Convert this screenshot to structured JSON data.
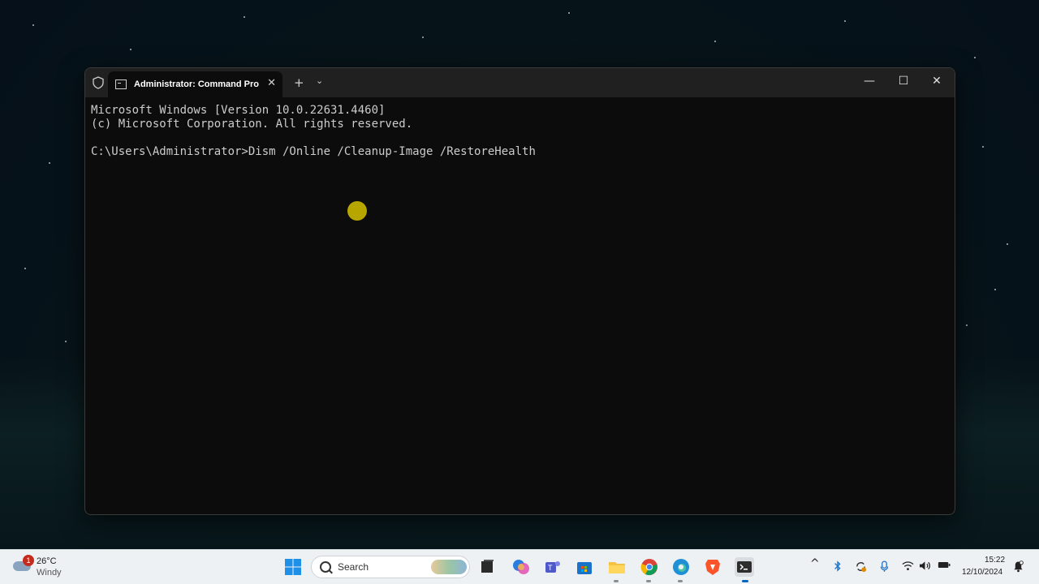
{
  "terminal": {
    "tab_title": "Administrator: Command Pro",
    "new_tab_label": "+",
    "dropdown_label": "⌄",
    "tab_close_label": "✕",
    "minimize_label": "—",
    "maximize_label": "☐",
    "close_label": "✕",
    "console_lines": [
      "Microsoft Windows [Version 10.0.22631.4460]",
      "(c) Microsoft Corporation. All rights reserved.",
      "",
      "C:\\Users\\Administrator>Dism /Online /Cleanup-Image /RestoreHealth"
    ]
  },
  "taskbar": {
    "weather": {
      "badge": "1",
      "temp": "26°C",
      "desc": "Windy"
    },
    "search": {
      "label": "Search"
    },
    "pinned": [
      {
        "name": "start-icon"
      },
      {
        "name": "task-view-icon"
      },
      {
        "name": "copilot-icon"
      },
      {
        "name": "teams-icon"
      },
      {
        "name": "store-icon"
      },
      {
        "name": "file-explorer-icon"
      },
      {
        "name": "chrome-icon"
      },
      {
        "name": "edge-icon"
      },
      {
        "name": "brave-icon"
      },
      {
        "name": "terminal-icon"
      }
    ],
    "tray": {
      "chevron": "^",
      "time": "15:22",
      "date": "12/10/2024"
    }
  },
  "colors": {
    "terminal_bg": "#0c0c0c",
    "titlebar_bg": "#202020",
    "cursor_highlight": "#c8b400",
    "taskbar_bg": "#eef1f4",
    "accent": "#0067c0"
  }
}
